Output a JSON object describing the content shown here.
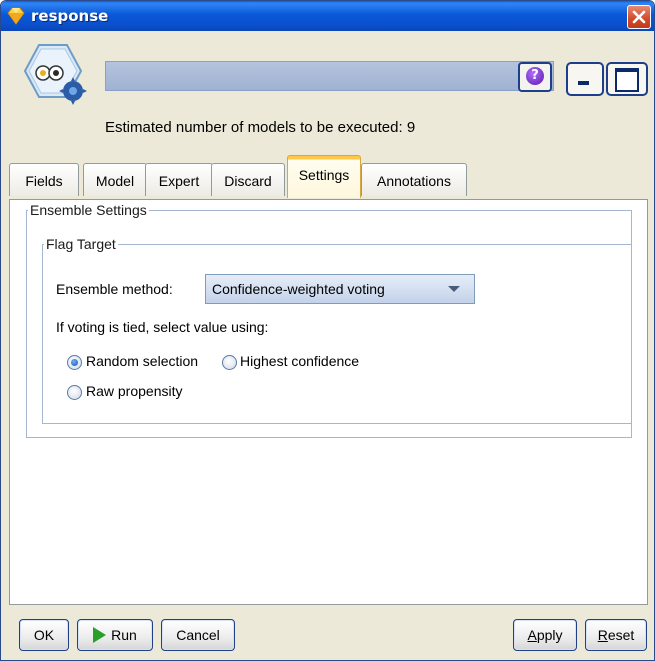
{
  "window": {
    "title": "response"
  },
  "header": {
    "node_name": "",
    "estimated_models_text": "Estimated number of models to be executed: 9",
    "help_label": "?"
  },
  "tabs": [
    {
      "label": "Fields",
      "active": false
    },
    {
      "label": "Model",
      "active": false
    },
    {
      "label": "Expert",
      "active": false
    },
    {
      "label": "Discard",
      "active": false
    },
    {
      "label": "Settings",
      "active": true
    },
    {
      "label": "Annotations",
      "active": false
    }
  ],
  "ensemble": {
    "group_label": "Ensemble Settings",
    "flag_target": {
      "group_label": "Flag Target",
      "method_label": "Ensemble method:",
      "method_value": "Confidence-weighted voting",
      "tie_label": "If voting is tied, select value using:",
      "options": [
        {
          "label": "Random selection",
          "checked": true
        },
        {
          "label": "Highest confidence",
          "checked": false
        },
        {
          "label": "Raw propensity",
          "checked": false
        }
      ]
    }
  },
  "buttons": {
    "ok": "OK",
    "run": "Run",
    "cancel": "Cancel",
    "apply_first": "A",
    "apply_rest": "pply",
    "reset_first": "R",
    "reset_rest": "eset"
  },
  "colors": {
    "titlebar": "#0a58d8",
    "active_tab_accent": "#ffc84a",
    "close_button": "#d04a2a",
    "run_arrow": "#28a028"
  },
  "icons": {
    "window": "diamond-logo-icon",
    "node": "auto-classifier-node-icon",
    "close": "close-icon",
    "help": "help-icon",
    "minimize": "minimize-icon",
    "maximize": "maximize-icon",
    "dropdown": "chevron-down-icon",
    "run": "play-icon"
  }
}
